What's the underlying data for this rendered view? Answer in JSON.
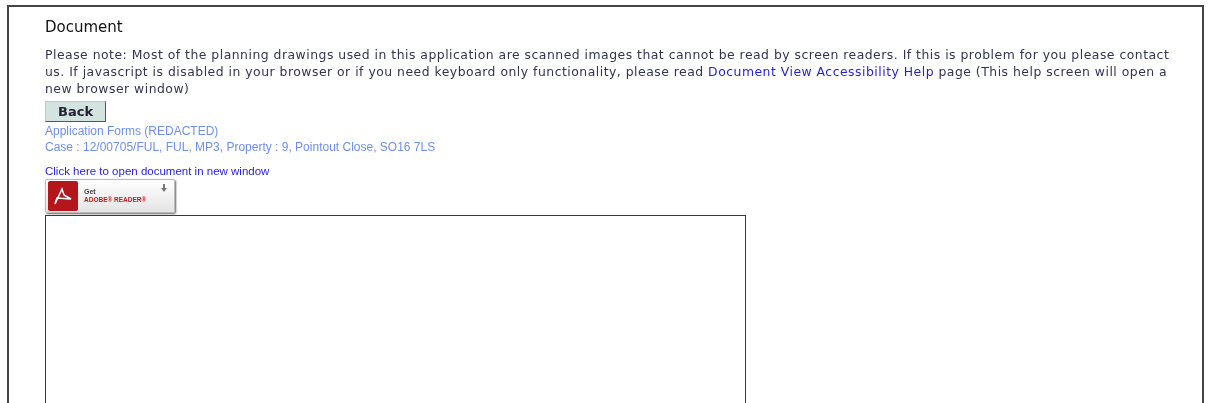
{
  "heading": "Document",
  "note": [
    {
      "kind": "text",
      "text": "Please note: Most of the planning drawings used in this application are scanned images that cannot be read by screen readers. If this is problem for you please contact us. If javascript is disabled in your browser or if you need keyboard only functionality, please read "
    },
    {
      "kind": "link",
      "text": "Document"
    },
    {
      "kind": "link",
      "text": "View Accessibility Help"
    },
    {
      "kind": "text",
      "text": " page (This help screen will open a new browser window)"
    }
  ],
  "back_button": "Back",
  "document_title": "Application Forms (REDACTED)",
  "case_info": "Case : 12/00705/FUL, FUL, MP3, Property : 9, Pointout Close, SO16 7LS",
  "open_link": "Click here to open document in new window",
  "reader_badge": {
    "line_1": "Get",
    "line_2": "ADOBE® READER®"
  }
}
